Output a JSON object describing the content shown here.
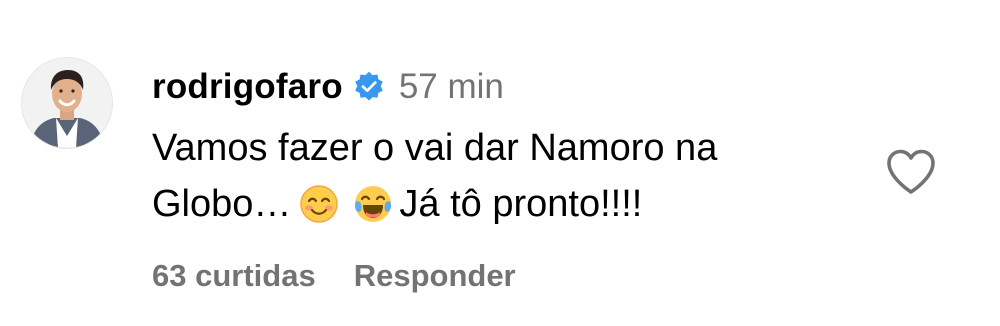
{
  "comment": {
    "username": "rodrigofaro",
    "verified": true,
    "timestamp": "57 min",
    "text_part1": "Vamos fazer o vai dar Namoro na\nGlobo…",
    "emoji_1": "smiling-face-icon",
    "emoji_2": "face-with-tears-of-joy-icon",
    "text_part2": "Já tô pronto!!!!",
    "likes": "63 curtidas",
    "reply_label": "Responder",
    "like_icon": "heart-icon"
  },
  "colors": {
    "verified_badge": "#3897f0",
    "secondary_text": "#737373",
    "primary_text": "#000000"
  }
}
